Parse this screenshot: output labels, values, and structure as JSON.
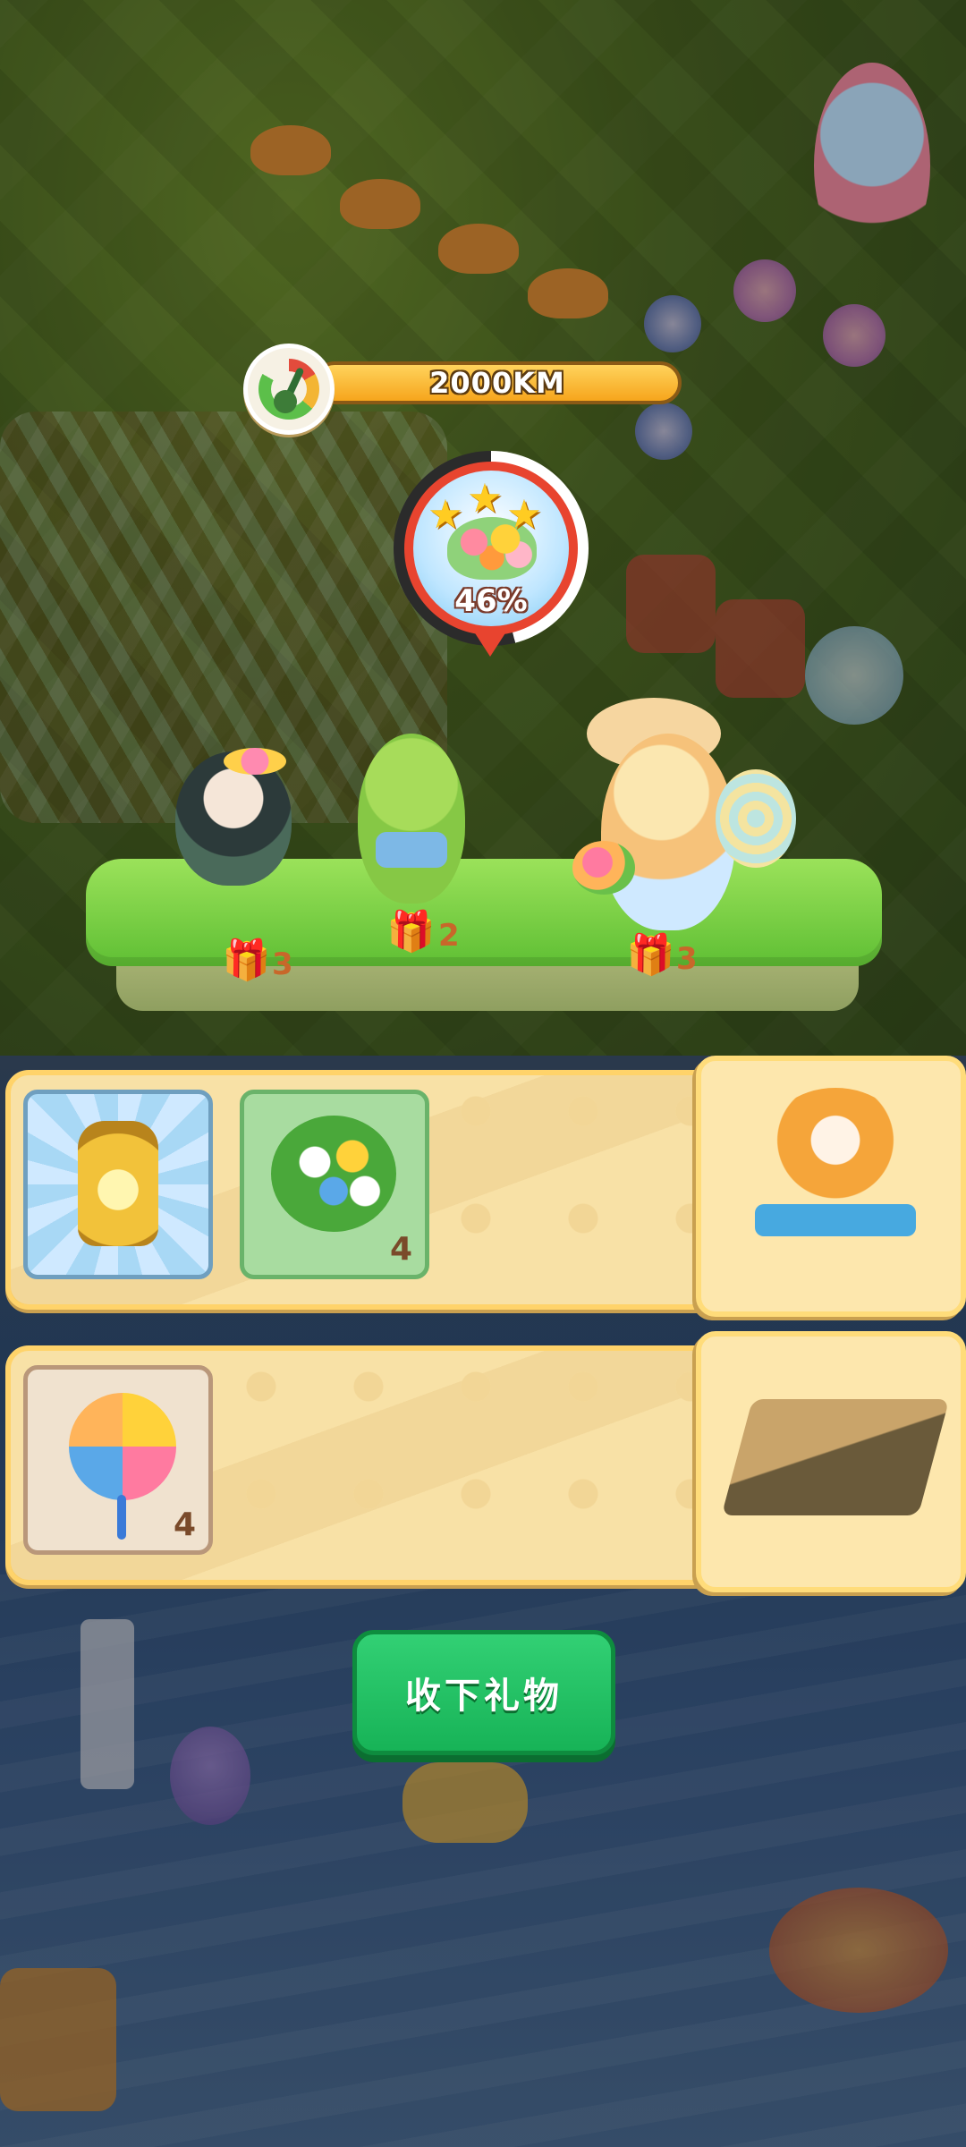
{
  "hud": {
    "distance": "2000KM"
  },
  "progress": {
    "percent_label": "46%",
    "percent": 46,
    "stars": 3
  },
  "characters": [
    {
      "name": "fairy-girl",
      "gift_count": "3"
    },
    {
      "name": "green-bear",
      "gift_count": "2"
    },
    {
      "name": "flower-fox",
      "gift_count": "3"
    }
  ],
  "rewards": {
    "row1": [
      {
        "icon": "golden-lantern-icon",
        "quantity": ""
      },
      {
        "icon": "flower-bush-icon",
        "quantity": "4"
      }
    ],
    "row1_side": {
      "icon": "cat-on-bench-icon"
    },
    "row2": [
      {
        "icon": "pinwheel-icon",
        "quantity": "4"
      }
    ],
    "row2_side": {
      "icon": "cellar-door-icon"
    }
  },
  "button": {
    "accept_label": "收下礼物"
  },
  "colors": {
    "button_green": "#1fbf62",
    "bar_orange": "#f6a51c",
    "badge_red": "#e8442f",
    "panel_cream": "#f8e1a6"
  }
}
